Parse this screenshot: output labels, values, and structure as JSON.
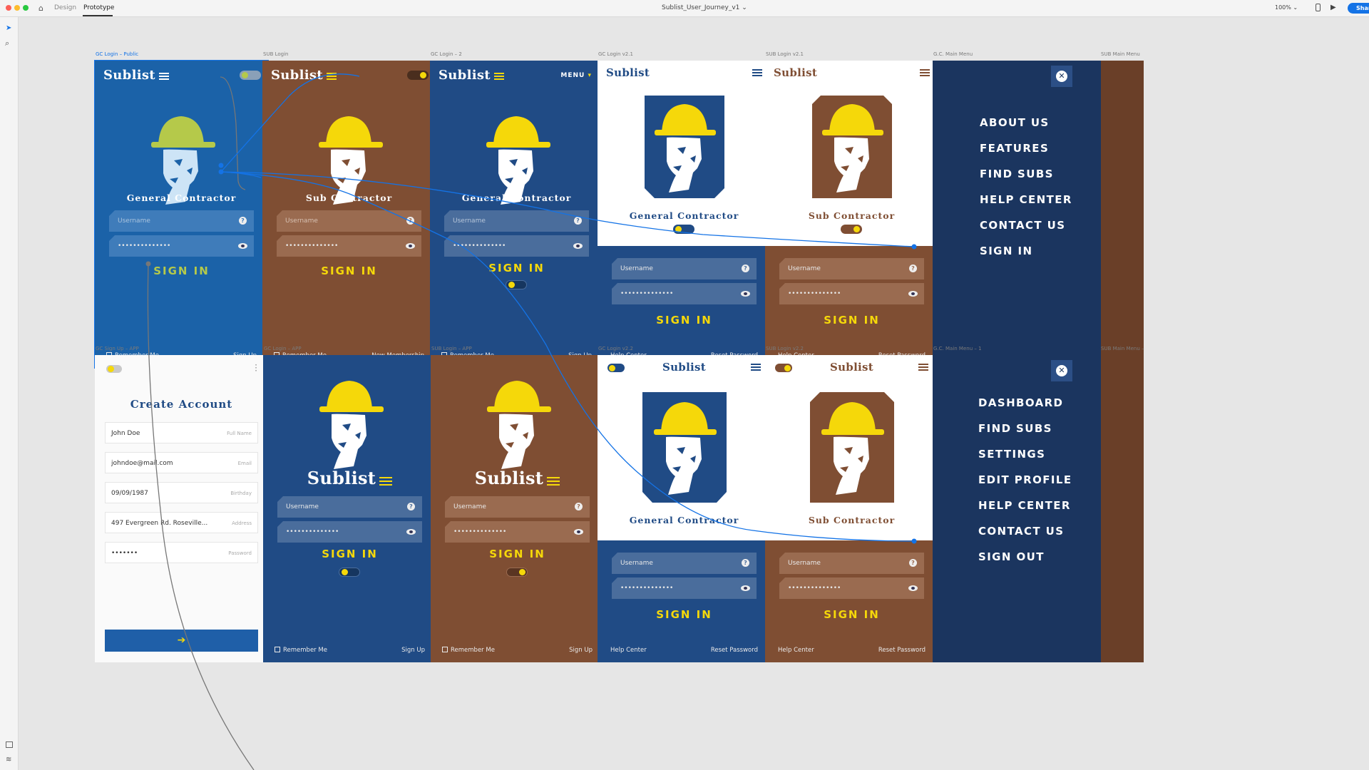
{
  "app": {
    "tabs": [
      "Design",
      "Prototype"
    ],
    "active_tab": "Prototype",
    "doc_title": "Sublist_User_Journey_v1",
    "zoom": "100%",
    "share": "Share"
  },
  "colors": {
    "gc_blue": "#1b62a8",
    "navy": "#204b85",
    "brown": "#7f4e33",
    "menu_navy": "#1b355f",
    "yellow": "#f5d80a",
    "olive": "#b5c94a"
  },
  "artboards": {
    "gc_login_public": {
      "label": "GC Login – Public",
      "logo": "Sublist",
      "role": "General Contractor",
      "username": "Username",
      "password": "••••••••••••••",
      "signin": "SIGN IN",
      "remember": "Remember Me",
      "link": "Sign Up"
    },
    "sub_login": {
      "label": "SUB Login",
      "logo": "Sublist",
      "role": "Sub Contractor",
      "username": "Username",
      "password": "••••••••••••••",
      "signin": "SIGN IN",
      "remember": "Remember Me",
      "link": "New Membership"
    },
    "gc_login_2": {
      "label": "GC Login – 2",
      "logo": "Sublist",
      "menu": "MENU",
      "role": "General Contractor",
      "username": "Username",
      "password": "••••••••••••••",
      "signin": "SIGN IN",
      "remember": "Remember Me",
      "link": "Sign Up"
    },
    "gc_login_v21": {
      "label": "GC Login v2.1",
      "logo": "Sublist",
      "role": "General Contractor",
      "username": "Username",
      "password": "••••••••••••••",
      "signin": "SIGN IN",
      "help": "Help Center",
      "reset": "Reset Password"
    },
    "sub_login_v21": {
      "label": "SUB Login v2.1",
      "logo": "Sublist",
      "role": "Sub Contractor",
      "username": "Username",
      "password": "••••••••••••••",
      "signin": "SIGN IN",
      "help": "Help Center",
      "reset": "Reset Password"
    },
    "gc_main_menu": {
      "label": "G.C. Main Menu",
      "items": [
        "ABOUT US",
        "FEATURES",
        "FIND SUBS",
        "HELP CENTER",
        "CONTACT US",
        "SIGN IN"
      ]
    },
    "sub_main_menu": {
      "label": "SUB Main Menu"
    },
    "gc_sign_up": {
      "label": "GC Sign Up – APP",
      "title": "Create Account",
      "rows": [
        {
          "value": "John Doe",
          "hint": "Full Name"
        },
        {
          "value": "johndoe@mail.com",
          "hint": "Email"
        },
        {
          "value": "09/09/1987",
          "hint": "Birthday"
        },
        {
          "value": "497 Evergreen Rd. Roseville...",
          "hint": "Address"
        },
        {
          "value": "•••••••",
          "hint": "Password"
        }
      ],
      "submit_icon": "arrow-right-icon"
    },
    "gc_login_app": {
      "label": "GC Login – APP",
      "logo": "Sublist",
      "username": "Username",
      "password": "••••••••••••••",
      "signin": "SIGN IN",
      "remember": "Remember Me",
      "link": "Sign Up"
    },
    "sub_login_app": {
      "label": "SUB Login – APP",
      "logo": "Sublist",
      "username": "Username",
      "password": "••••••••••••••",
      "signin": "SIGN IN",
      "remember": "Remember Me",
      "link": "Sign Up"
    },
    "gc_login_v22": {
      "label": "GC Login v2.2",
      "logo": "Sublist",
      "role": "General Contractor",
      "username": "Username",
      "password": "••••••••••••••",
      "signin": "SIGN IN",
      "help": "Help Center",
      "reset": "Reset Password"
    },
    "sub_login_v22": {
      "label": "SUB Login v2.2",
      "logo": "Sublist",
      "role": "Sub Contractor",
      "username": "Username",
      "password": "••••••••••••••",
      "signin": "SIGN IN",
      "help": "Help Center",
      "reset": "Reset Password"
    },
    "gc_main_menu_1": {
      "label": "G.C. Main Menu – 1",
      "items": [
        "DASHBOARD",
        "FIND SUBS",
        "SETTINGS",
        "EDIT PROFILE",
        "HELP CENTER",
        "CONTACT US",
        "SIGN OUT"
      ]
    },
    "sub_main_menu_2": {
      "label": "SUB Main Menu –"
    }
  }
}
